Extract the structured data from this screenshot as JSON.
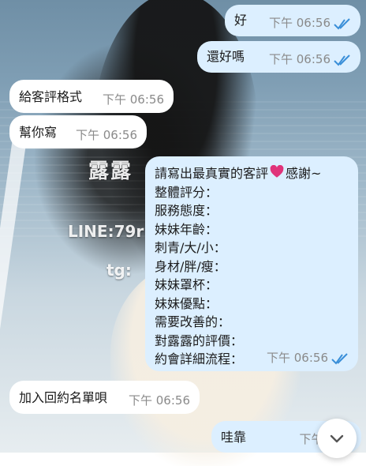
{
  "background": {
    "watermark_name": "露露",
    "watermark_line": "LINE:79r",
    "watermark_tg": "tg:"
  },
  "messages": [
    {
      "direction": "out",
      "text": "好",
      "time": "下午 06:56",
      "read": true
    },
    {
      "direction": "out",
      "text": "還好嗎",
      "time": "下午 06:56",
      "read": true
    },
    {
      "direction": "in",
      "text": "給客評格式",
      "time": "下午 06:56"
    },
    {
      "direction": "in",
      "text": "幫你寫",
      "time": "下午 06:56"
    },
    {
      "direction": "out",
      "lines": [
        "請寫出最真實的客評",
        "感謝~",
        "整體評分：",
        "服務態度：",
        "妹妹年齡：",
        "刺青/大/小：",
        "身材/胖/瘦：",
        "妹妹罩杯：",
        "妹妹優點：",
        "需要改善的：",
        "對露露的評價：",
        "約會詳細流程："
      ],
      "time": "下午 06:56",
      "read": true,
      "emoji": "heart-icon"
    },
    {
      "direction": "in",
      "text": "加入回約名單唄",
      "time": "下午 06:56"
    },
    {
      "direction": "out",
      "text": "哇靠",
      "time": "下午 06:5",
      "read": false
    }
  ],
  "colors": {
    "outgoing_bubble": "#dcefff",
    "incoming_bubble": "#ffffff",
    "read_check": "#3a8fd8",
    "heart": "#e0337a"
  },
  "controls": {
    "scroll_down_icon": "chevron-down-icon"
  }
}
